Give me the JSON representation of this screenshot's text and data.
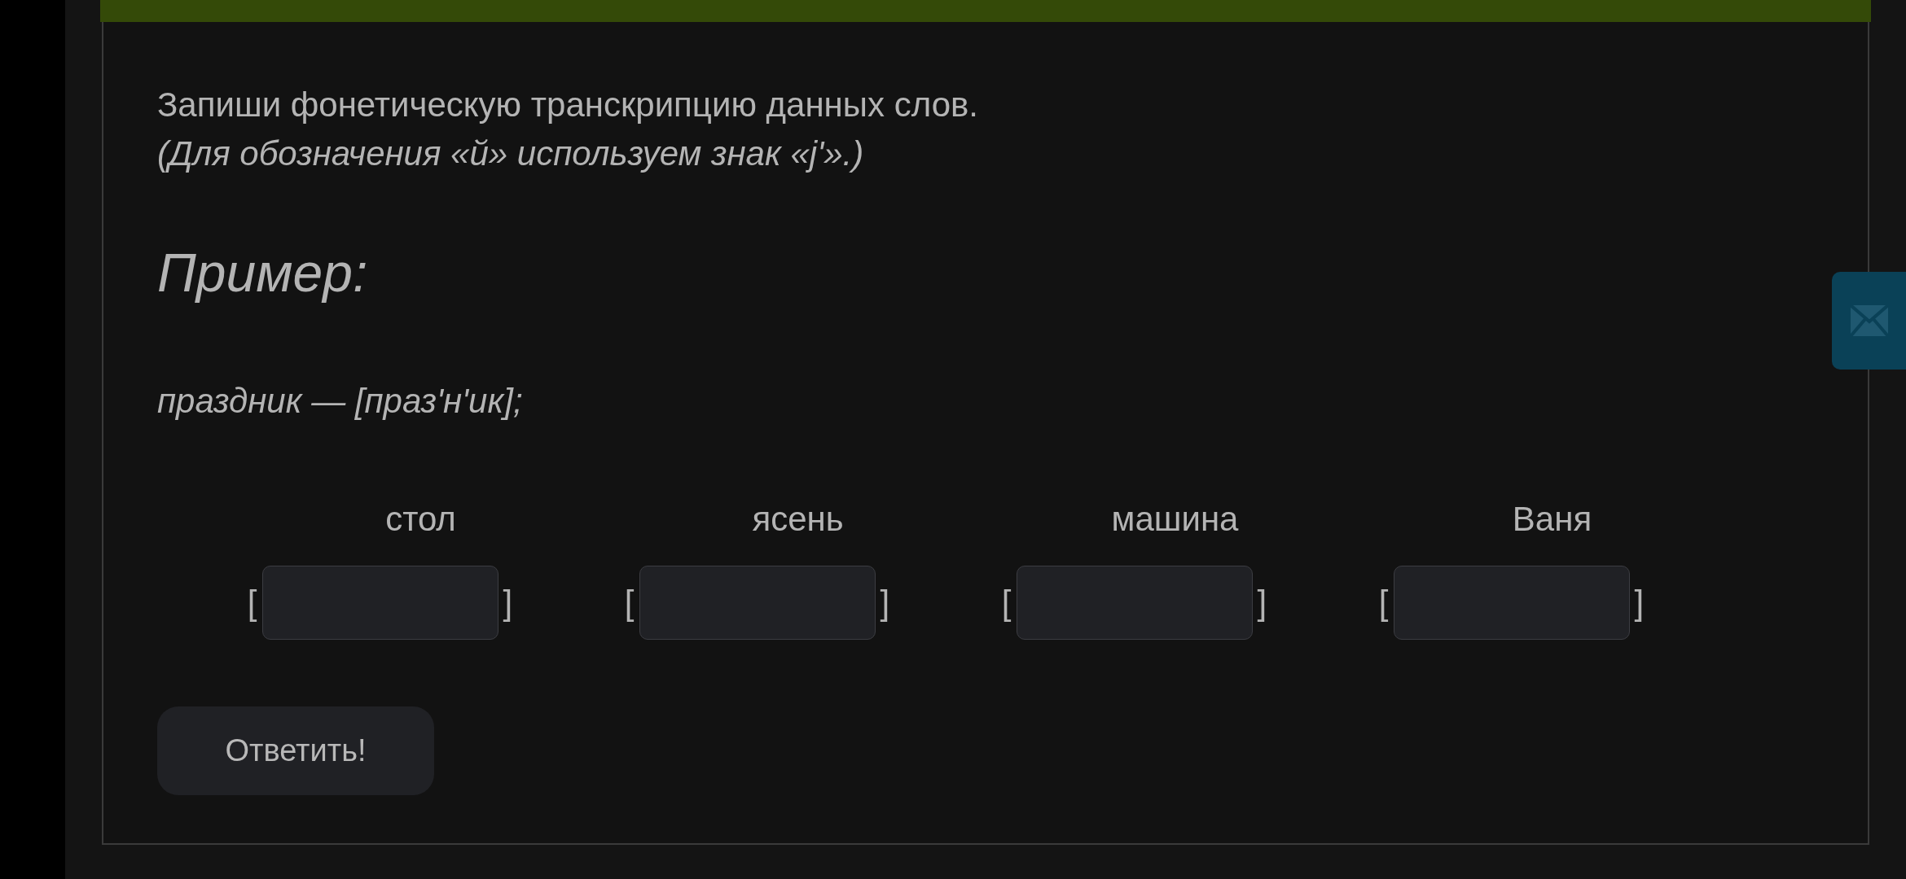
{
  "task": {
    "instruction": "Запиши фонетическую транскрипцию данных слов.",
    "note": "(Для обозначения «й» используем знак «j'».)",
    "example_heading": "Пример:",
    "example": "праздник — [праз'н'ик];",
    "words": [
      {
        "word": "стол",
        "open_bracket": "[",
        "close_bracket": "]"
      },
      {
        "word": "ясень",
        "open_bracket": "[",
        "close_bracket": "]"
      },
      {
        "word": "машина",
        "open_bracket": "[",
        "close_bracket": "]"
      },
      {
        "word": "Ваня",
        "open_bracket": "[",
        "close_bracket": "]"
      }
    ],
    "submit_button": "Ответить!"
  }
}
